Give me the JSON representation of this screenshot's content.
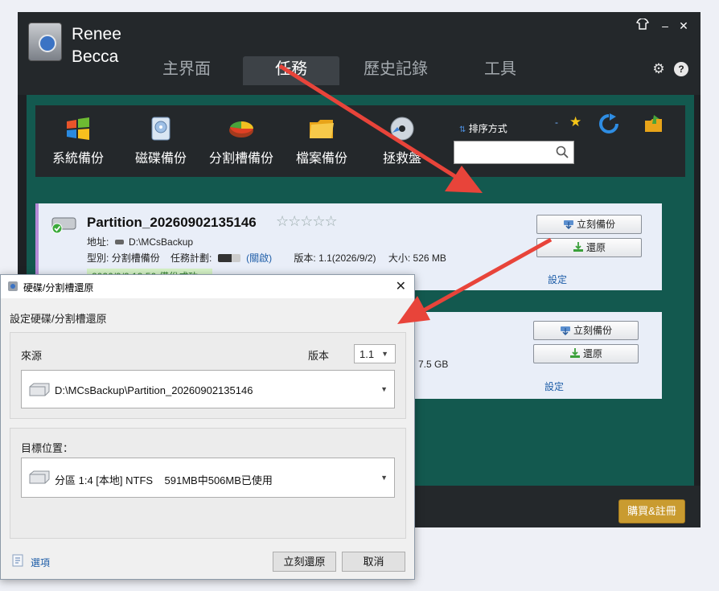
{
  "app": {
    "brand": "Renee\nBecca",
    "nav_tabs": [
      "主界面",
      "任務",
      "歷史記錄",
      "工具"
    ],
    "active_tab": "任務",
    "window_controls": [
      "minimize",
      "close"
    ]
  },
  "toolbar": {
    "items": [
      {
        "label": "系統備份",
        "icon": "windows-flag-icon"
      },
      {
        "label": "磁碟備份",
        "icon": "disk-icon"
      },
      {
        "label": "分割槽備份",
        "icon": "pie-chart-icon"
      },
      {
        "label": "檔案備份",
        "icon": "folder-icon"
      },
      {
        "label": "拯救盤",
        "icon": "cd-icon"
      }
    ],
    "sort_label": "排序方式",
    "search_placeholder": ""
  },
  "tasks": [
    {
      "title": "Partition_20260902135146",
      "address_label": "地址:",
      "address": "D:\\MCsBackup",
      "type_label": "型別:",
      "type": "分割槽備份",
      "schedule_label": "任務計劃:",
      "schedule_state": "(關啟)",
      "version_label": "版本:",
      "version": "1.1(2026/9/2)",
      "size_label": "大小:",
      "size": "526 MB",
      "status": "2026/9/2 13:56-備份成功。",
      "backup_btn": "立刻備份",
      "restore_btn": "還原",
      "settings_link": "設定"
    },
    {
      "size_fragment": "7.5 GB",
      "backup_btn": "立刻備份",
      "restore_btn": "還原",
      "settings_link": "設定"
    }
  ],
  "footer": {
    "buy_btn": "購買&註冊",
    "partial_text": "!"
  },
  "dialog": {
    "title": "硬碟/分割槽還原",
    "subtitle": "設定硬碟/分割槽還原",
    "source_label": "來源",
    "version_label": "版本",
    "version_value": "1.1",
    "source_value": "D:\\MCsBackup\\Partition_20260902135146",
    "target_label": "目標位置：",
    "target_value": "分區 1:4 [本地] NTFS    591MB中506MB已使用",
    "options_link": "選項",
    "restore_btn": "立刻還原",
    "cancel_btn": "取消"
  },
  "colors": {
    "app_bg": "#1e2124",
    "panel_teal": "#13594f",
    "card_bg": "#e9eef8",
    "buy_gold": "#c99b30",
    "arrow_red": "#e8443a",
    "link_blue": "#1f5ea8"
  }
}
